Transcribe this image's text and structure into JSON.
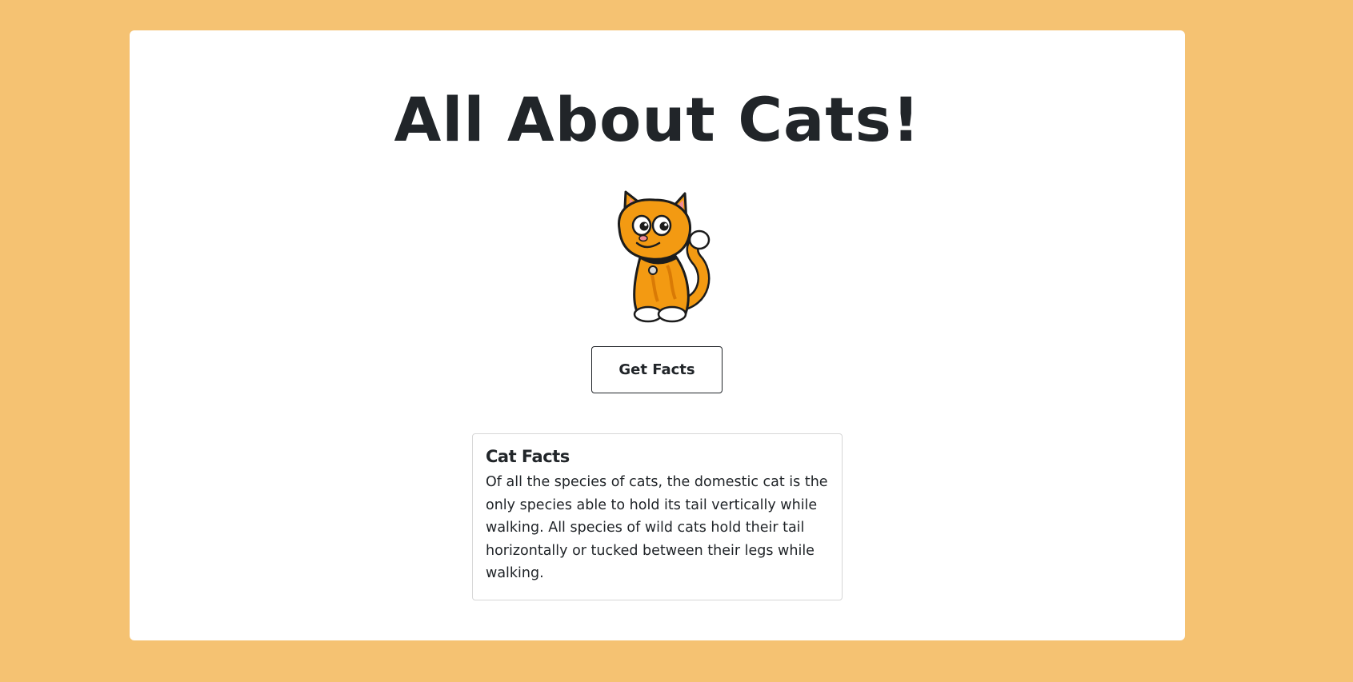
{
  "page": {
    "title": "All About Cats!",
    "background_color": "#f5c272",
    "card_color": "#ffffff"
  },
  "hero_image": {
    "icon": "cartoon-orange-cat"
  },
  "actions": {
    "get_facts_label": "Get Facts"
  },
  "facts": {
    "heading": "Cat Facts",
    "text": "Of all the species of cats, the domestic cat is the only species able to hold its tail vertically while walking. All species of wild cats hold their tail horizontally or tucked between their legs while walking."
  }
}
